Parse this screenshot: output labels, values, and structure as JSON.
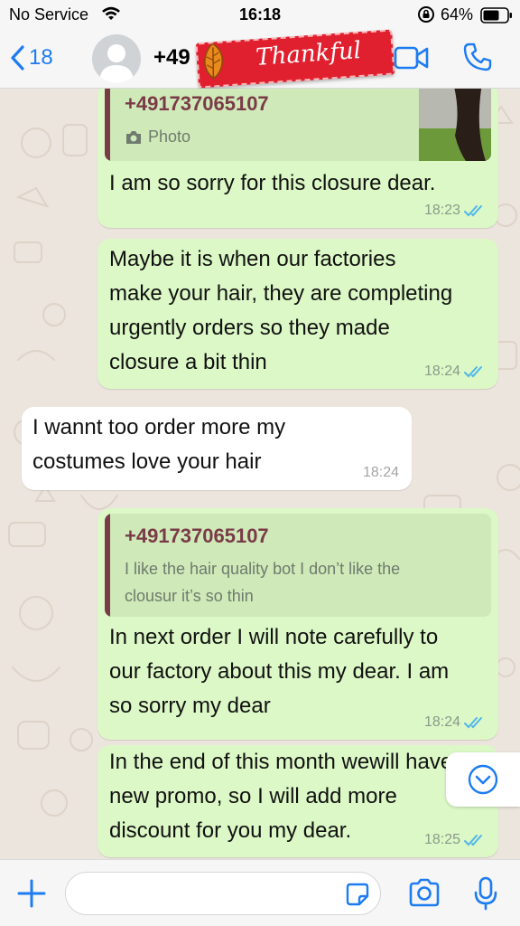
{
  "status_bar": {
    "carrier": "No Service",
    "time": "16:18",
    "battery_percent": "64%"
  },
  "header": {
    "back_count": "18",
    "contact_name": "+49",
    "sticker_text": "Thankful"
  },
  "messages": [
    {
      "direction": "outgoing",
      "quote": {
        "sender": "+491737065107",
        "body": "Photo",
        "icon": "camera-icon",
        "has_thumbnail": true
      },
      "text": "I am so sorry for this closure dear.",
      "time": "18:23",
      "status": "read"
    },
    {
      "direction": "outgoing",
      "lines": [
        "Maybe it is when our factories",
        "make your hair, they are completing",
        "urgently orders so they made",
        "closure a bit thin"
      ],
      "time": "18:24",
      "status": "read"
    },
    {
      "direction": "incoming",
      "lines": [
        "I wannt too order more my",
        "costumes love your hair"
      ],
      "time": "18:24"
    },
    {
      "direction": "outgoing",
      "quote": {
        "sender": "+491737065107",
        "lines": [
          "I like the hair quality bot I don’t like the",
          "clousur it’s so thin"
        ]
      },
      "lines": [
        "In next order I will note carefully to",
        "our factory about this my dear. I am",
        "so sorry my dear"
      ],
      "time": "18:24",
      "status": "read"
    },
    {
      "direction": "outgoing",
      "lines": [
        "In the end of this month wewill have",
        "new promo, so I will add more",
        "discount for you my dear."
      ],
      "time": "18:25",
      "status": "read"
    }
  ],
  "input": {
    "value": "",
    "placeholder": ""
  },
  "colors": {
    "accent": "#1d7cf2",
    "outgoing_bubble": "#dcf8c6",
    "incoming_bubble": "#ffffff",
    "quote_sender": "#7a3b48",
    "read_ticks": "#4fb6ec",
    "sticker": "#e0202e"
  }
}
